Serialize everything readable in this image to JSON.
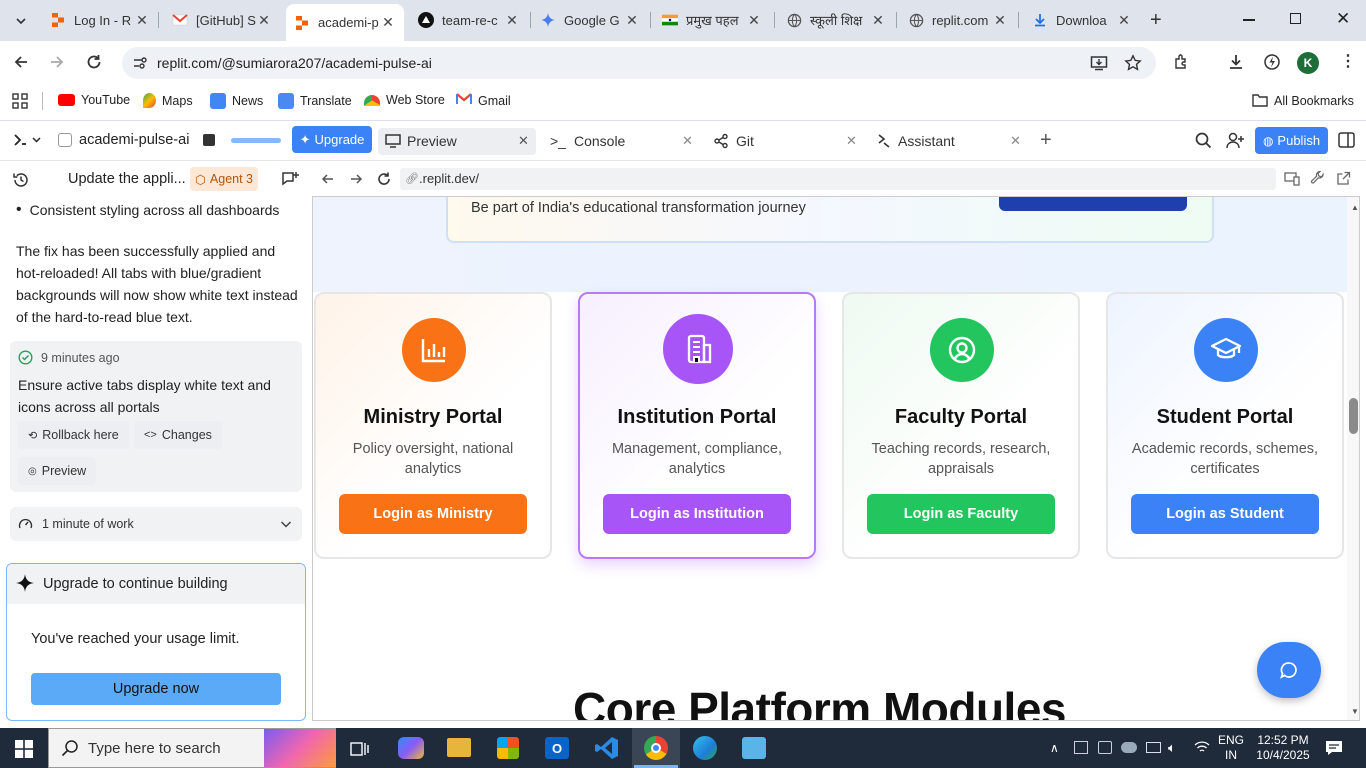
{
  "browser": {
    "tabs": [
      {
        "title": "Log In - R",
        "icon": "replit-icon"
      },
      {
        "title": "[GitHub] S",
        "icon": "gmail-icon"
      },
      {
        "title": "academi-p",
        "icon": "replit-icon",
        "active": true
      },
      {
        "title": "team-re-c",
        "icon": "vercel-icon"
      },
      {
        "title": "Google G",
        "icon": "gemini-icon"
      },
      {
        "title": "प्रमुख पहल",
        "icon": "india-flag-icon"
      },
      {
        "title": "स्कूली शिक्ष",
        "icon": "globe-icon"
      },
      {
        "title": "replit.com",
        "icon": "globe-icon"
      },
      {
        "title": "Downloa",
        "icon": "download-icon"
      }
    ],
    "url": "replit.com/@sumiarora207/academi-pulse-ai",
    "profile_initial": "K",
    "bookmarks": [
      "YouTube",
      "Maps",
      "News",
      "Translate",
      "Web Store",
      "Gmail"
    ],
    "all_bookmarks": "All Bookmarks"
  },
  "replit": {
    "project_name": "academi-pulse-ai",
    "upgrade_label": "Upgrade",
    "tabs": [
      "Preview",
      "Console",
      "Git",
      "Assistant"
    ],
    "publish_label": "Publish",
    "preview_url": ".replit.dev/"
  },
  "chat": {
    "header_title": "Update the appli...",
    "agent_badge": "Agent 3",
    "bullet": "Consistent styling across all dashboards",
    "message": "The fix has been successfully applied and hot-reloaded! All tabs with blue/gradient backgrounds will now show white text instead of the hard-to-read blue text.",
    "checkpoint_time": "9 minutes ago",
    "checkpoint_title": "Ensure active tabs display white text and icons across all portals",
    "rollback_label": "Rollback here",
    "changes_label": "Changes",
    "preview_label": "Preview",
    "work_label": "1 minute of work",
    "upgrade_title": "Upgrade to continue building",
    "upgrade_text": "You've reached your usage limit.",
    "upgrade_button": "Upgrade now"
  },
  "site": {
    "banner_text": "Be part of India's educational transformation journey",
    "section_title": "Core Platform Modules",
    "portals": [
      {
        "title": "Ministry Portal",
        "desc": "Policy oversight, national analytics",
        "button": "Login as Ministry",
        "color": "#f97316",
        "icon": "chart-bars-icon"
      },
      {
        "title": "Institution Portal",
        "desc": "Management, compliance, analytics",
        "button": "Login as Institution",
        "color": "#a855f7",
        "icon": "building-icon"
      },
      {
        "title": "Faculty Portal",
        "desc": "Teaching records, research, appraisals",
        "button": "Login as Faculty",
        "color": "#22c55e",
        "icon": "user-circle-icon"
      },
      {
        "title": "Student Portal",
        "desc": "Academic records, schemes, certificates",
        "button": "Login as Student",
        "color": "#3b82f6",
        "icon": "graduation-cap-icon"
      }
    ]
  },
  "taskbar": {
    "search_placeholder": "Type here to search",
    "lang": "ENG",
    "region": "IN",
    "time": "12:52 PM",
    "date": "10/4/2025"
  }
}
